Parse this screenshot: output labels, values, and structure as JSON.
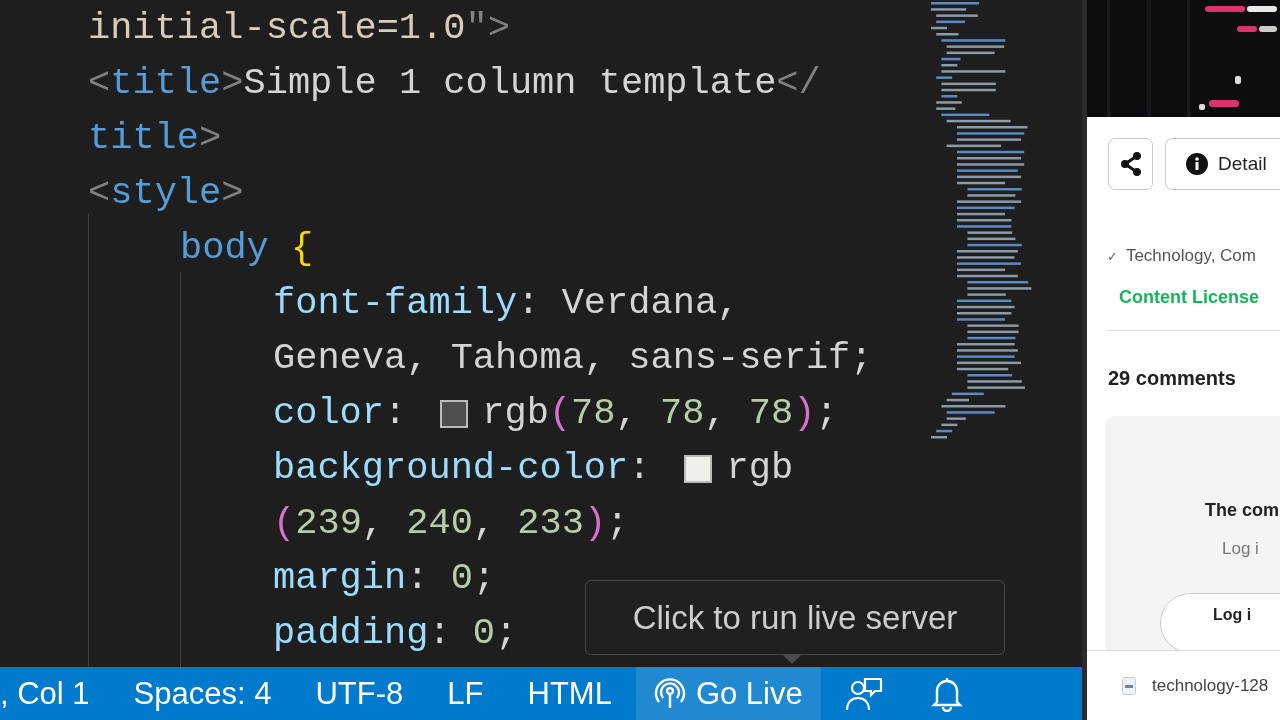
{
  "editor": {
    "lines": [
      {
        "kind": "markup",
        "runs": [
          [
            {
              "kind": "string",
              "text": "initial-scale=1.0"
            },
            {
              "kind": "punct",
              "text": "\">"
            }
          ]
        ]
      },
      {
        "kind": "markup",
        "runs": [
          [
            {
              "kind": "punct",
              "text": "<"
            },
            {
              "kind": "tag",
              "text": "title"
            },
            {
              "kind": "punct",
              "text": ">"
            },
            {
              "kind": "plain",
              "text": "Simple 1 column template"
            },
            {
              "kind": "punct",
              "text": "</"
            }
          ]
        ]
      },
      {
        "kind": "markup",
        "runs": [
          [
            {
              "kind": "tag",
              "text": "title"
            },
            {
              "kind": "punct",
              "text": ">"
            }
          ]
        ]
      },
      {
        "kind": "markup",
        "runs": [
          [
            {
              "kind": "punct",
              "text": "<"
            },
            {
              "kind": "tag",
              "text": "style"
            },
            {
              "kind": "punct",
              "text": ">"
            }
          ]
        ]
      },
      {
        "kind": "rule",
        "runs": [
          [
            {
              "kind": "tag",
              "text": "body"
            },
            {
              "kind": "brace",
              "text": " {"
            }
          ]
        ]
      },
      {
        "kind": "declaration",
        "runs": [
          [
            {
              "kind": "prop",
              "text": "font-family"
            },
            {
              "kind": "plain",
              "text": ": Verdana,"
            }
          ]
        ]
      },
      {
        "kind": "declaration",
        "runs": [
          [
            {
              "kind": "plain",
              "text": "Geneva, Tahoma, sans-serif;"
            }
          ]
        ]
      },
      {
        "kind": "declaration",
        "runs": [
          [
            {
              "kind": "prop",
              "text": "color"
            },
            {
              "kind": "plain",
              "text": ":"
            }
          ],
          {
            "kind": "swatch",
            "color": "#4e4e4e"
          },
          [
            {
              "kind": "plain",
              "text": "rgb"
            },
            {
              "kind": "paren",
              "text": "("
            },
            {
              "kind": "num",
              "text": "78"
            },
            {
              "kind": "plain",
              "text": ", "
            },
            {
              "kind": "num",
              "text": "78"
            },
            {
              "kind": "plain",
              "text": ", "
            },
            {
              "kind": "num",
              "text": "78"
            },
            {
              "kind": "paren",
              "text": ")"
            },
            {
              "kind": "plain",
              "text": ";"
            }
          ]
        ]
      },
      {
        "kind": "declaration",
        "runs": [
          [
            {
              "kind": "prop",
              "text": "background-color"
            },
            {
              "kind": "plain",
              "text": ":"
            }
          ],
          {
            "kind": "swatch",
            "color": "#eff0e9"
          },
          [
            {
              "kind": "plain",
              "text": "rgb"
            }
          ]
        ]
      },
      {
        "kind": "declaration",
        "runs": [
          [
            {
              "kind": "paren",
              "text": "("
            },
            {
              "kind": "num",
              "text": "239"
            },
            {
              "kind": "plain",
              "text": ", "
            },
            {
              "kind": "num",
              "text": "240"
            },
            {
              "kind": "plain",
              "text": ", "
            },
            {
              "kind": "num",
              "text": "233"
            },
            {
              "kind": "paren",
              "text": ")"
            },
            {
              "kind": "plain",
              "text": ";"
            }
          ]
        ]
      },
      {
        "kind": "declaration",
        "runs": [
          [
            {
              "kind": "prop",
              "text": "margin"
            },
            {
              "kind": "plain",
              "text": ": "
            },
            {
              "kind": "num",
              "text": "0"
            },
            {
              "kind": "plain",
              "text": ";"
            }
          ]
        ]
      },
      {
        "kind": "declaration",
        "runs": [
          [
            {
              "kind": "prop",
              "text": "padding"
            },
            {
              "kind": "plain",
              "text": ": "
            },
            {
              "kind": "num",
              "text": "0"
            },
            {
              "kind": "plain",
              "text": ";"
            }
          ]
        ]
      }
    ]
  },
  "tooltip": "Click to run live server",
  "status_bar": [
    {
      "kind": "text",
      "label": ", Col 1"
    },
    {
      "kind": "text",
      "label": "Spaces: 4"
    },
    {
      "kind": "text",
      "label": "UTF-8"
    },
    {
      "kind": "text",
      "label": "LF"
    },
    {
      "kind": "text",
      "label": "HTML"
    },
    {
      "kind": "golive",
      "label": "Go Live"
    },
    {
      "kind": "feedback"
    },
    {
      "kind": "bell"
    }
  ],
  "browser": {
    "details_button": "Detail",
    "tags_check": "✓",
    "tags": "Technology, Com",
    "license_link": "Content License",
    "comments_heading": "29 comments",
    "comment_notice": "The com",
    "login_hint": "Log i",
    "login_button": "Log i",
    "download": "technology-128"
  }
}
